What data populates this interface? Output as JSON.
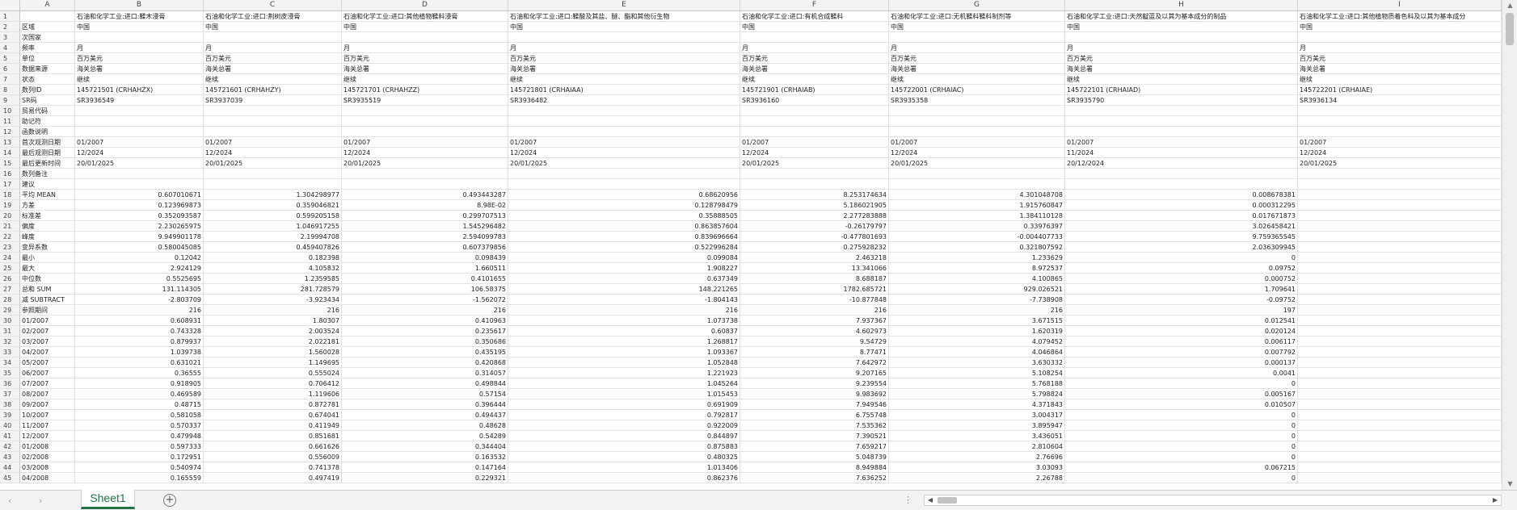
{
  "columns": [
    "A",
    "B",
    "C",
    "D",
    "E",
    "F",
    "G",
    "H",
    "I"
  ],
  "rows": [
    [
      "1",
      "",
      "石油和化学工业:进口:鞣木浸膏",
      "石油和化学工业:进口:荆树皮浸膏",
      "石油和化学工业:进口:其他植物鞣料浸膏",
      "石油和化学工业:进口:鞣酸及其盐、醚、酯和其他衍生物",
      "石油和化学工业:进口:有机合成鞣料",
      "石油和化学工业:进口:无机鞣料鞣料制剂等",
      "石油和化学工业:进口:天然靛蓝及以其为基本成分的制品",
      "石油和化学工业:进口:其他植物质着色料及以其为基本成分"
    ],
    [
      "2",
      "区域",
      "中国",
      "中国",
      "中国",
      "中国",
      "中国",
      "中国",
      "中国",
      "中国"
    ],
    [
      "3",
      "次国家",
      "",
      "",
      "",
      "",
      "",
      "",
      "",
      ""
    ],
    [
      "4",
      "频率",
      "月",
      "月",
      "月",
      "月",
      "月",
      "月",
      "月",
      "月"
    ],
    [
      "5",
      "单位",
      "百万美元",
      "百万美元",
      "百万美元",
      "百万美元",
      "百万美元",
      "百万美元",
      "百万美元",
      "百万美元"
    ],
    [
      "6",
      "数据来源",
      "海关总署",
      "海关总署",
      "海关总署",
      "海关总署",
      "海关总署",
      "海关总署",
      "海关总署",
      "海关总署"
    ],
    [
      "7",
      "状态",
      "继续",
      "继续",
      "继续",
      "继续",
      "继续",
      "继续",
      "继续",
      "继续"
    ],
    [
      "8",
      "数列ID",
      "145721501 (CRHAHZX)",
      "145721601 (CRHAHZY)",
      "145721701 (CRHAHZZ)",
      "145721801 (CRHAIAA)",
      "145721901 (CRHAIAB)",
      "145722001 (CRHAIAC)",
      "145722101 (CRHAIAD)",
      "145722201 (CRHAIAE)"
    ],
    [
      "9",
      "SR码",
      "SR3936549",
      "SR3937039",
      "SR3935519",
      "SR3936482",
      "SR3936160",
      "SR3935358",
      "SR3935790",
      "SR3936134"
    ],
    [
      "10",
      "贸易代码",
      "",
      "",
      "",
      "",
      "",
      "",
      "",
      ""
    ],
    [
      "11",
      "助记符",
      "",
      "",
      "",
      "",
      "",
      "",
      "",
      ""
    ],
    [
      "12",
      "函数说明",
      "",
      "",
      "",
      "",
      "",
      "",
      "",
      ""
    ],
    [
      "13",
      "首次观测日期",
      "01/2007",
      "01/2007",
      "01/2007",
      "01/2007",
      "01/2007",
      "01/2007",
      "01/2007",
      "01/2007"
    ],
    [
      "14",
      "最后观测日期",
      "12/2024",
      "12/2024",
      "12/2024",
      "12/2024",
      "12/2024",
      "12/2024",
      "11/2024",
      "12/2024"
    ],
    [
      "15",
      "最后更新时间",
      "20/01/2025",
      "20/01/2025",
      "20/01/2025",
      "20/01/2025",
      "20/01/2025",
      "20/01/2025",
      "20/12/2024",
      "20/01/2025"
    ],
    [
      "16",
      "数列备注",
      "",
      "",
      "",
      "",
      "",
      "",
      "",
      ""
    ],
    [
      "17",
      "建议",
      "",
      "",
      "",
      "",
      "",
      "",
      "",
      ""
    ],
    [
      "18",
      "平均 MEAN",
      "0.607010671",
      "1.304298977",
      "0.493443287",
      "0.68620956",
      "8.253174634",
      "4.301048708",
      "0.008678381",
      ""
    ],
    [
      "19",
      "方差",
      "0.123969873",
      "0.359046821",
      "8.98E-02",
      "0.128798479",
      "5.186021905",
      "1.915760847",
      "0.000312295",
      ""
    ],
    [
      "20",
      "标准差",
      "0.352093587",
      "0.599205158",
      "0.299707513",
      "0.35888505",
      "2.277283888",
      "1.384110128",
      "0.017671873",
      ""
    ],
    [
      "21",
      "偏度",
      "2.230265975",
      "1.046917255",
      "1.545296482",
      "0.863857604",
      "-0.26179797",
      "0.33976397",
      "3.026458421",
      ""
    ],
    [
      "22",
      "峰度",
      "9.949901178",
      "2.19994708",
      "2.594099783",
      "0.839696664",
      "-0.477801693",
      "-0.004407733",
      "9.759365545",
      ""
    ],
    [
      "23",
      "变异系数",
      "0.580045085",
      "0.459407826",
      "0.607379856",
      "0.522996284",
      "0.275928232",
      "0.321807592",
      "2.036309945",
      ""
    ],
    [
      "24",
      "最小",
      "0.12042",
      "0.182398",
      "0.098439",
      "0.099084",
      "2.463218",
      "1.233629",
      "0",
      ""
    ],
    [
      "25",
      "最大",
      "2.924129",
      "4.105832",
      "1.660511",
      "1.908227",
      "13.341066",
      "8.972537",
      "0.09752",
      ""
    ],
    [
      "26",
      "中位数",
      "0.5525695",
      "1.2359585",
      "0.4101655",
      "0.637349",
      "8.688187",
      "4.100865",
      "0.000752",
      ""
    ],
    [
      "27",
      "总和 SUM",
      "131.114305",
      "281.728579",
      "106.58375",
      "148.221265",
      "1782.685721",
      "929.026521",
      "1.709641",
      ""
    ],
    [
      "28",
      "减 SUBTRACT",
      "-2.803709",
      "-3.923434",
      "-1.562072",
      "-1.804143",
      "-10.877848",
      "-7.738908",
      "-0.09752",
      ""
    ],
    [
      "29",
      "参照期间",
      "216",
      "216",
      "216",
      "216",
      "216",
      "216",
      "197",
      ""
    ],
    [
      "30",
      "01/2007",
      "0.608931",
      "1.80307",
      "0.410963",
      "1.073738",
      "7.937367",
      "3.671515",
      "0.012541",
      ""
    ],
    [
      "31",
      "02/2007",
      "0.743328",
      "2.003524",
      "0.235617",
      "0.60837",
      "4.602973",
      "1.620319",
      "0.020124",
      ""
    ],
    [
      "32",
      "03/2007",
      "0.879937",
      "2.022181",
      "0.350686",
      "1.268817",
      "9.54729",
      "4.079452",
      "0.006117",
      ""
    ],
    [
      "33",
      "04/2007",
      "1.039738",
      "1.560028",
      "0.435195",
      "1.093367",
      "8.77471",
      "4.046864",
      "0.007792",
      ""
    ],
    [
      "34",
      "05/2007",
      "0.631021",
      "1.149695",
      "0.420868",
      "1.052848",
      "7.642972",
      "3.630332",
      "0.000137",
      ""
    ],
    [
      "35",
      "06/2007",
      "0.36555",
      "0.555024",
      "0.314057",
      "1.221923",
      "9.207165",
      "5.108254",
      "0.0041",
      ""
    ],
    [
      "36",
      "07/2007",
      "0.918905",
      "0.706412",
      "0.498844",
      "1.045264",
      "9.239554",
      "5.768188",
      "0",
      ""
    ],
    [
      "37",
      "08/2007",
      "0.469589",
      "1.119606",
      "0.57154",
      "1.015453",
      "9.983692",
      "5.798824",
      "0.005167",
      ""
    ],
    [
      "38",
      "09/2007",
      "0.48715",
      "0.872781",
      "0.396444",
      "0.691909",
      "7.949546",
      "4.371843",
      "0.010507",
      ""
    ],
    [
      "39",
      "10/2007",
      "0.581058",
      "0.674041",
      "0.494437",
      "0.792817",
      "6.755748",
      "3.004317",
      "0",
      ""
    ],
    [
      "40",
      "11/2007",
      "0.570337",
      "0.411949",
      "0.48628",
      "0.922009",
      "7.535362",
      "3.895947",
      "0",
      ""
    ],
    [
      "41",
      "12/2007",
      "0.479948",
      "0.851681",
      "0.54289",
      "0.844897",
      "7.390521",
      "3.436051",
      "0",
      ""
    ],
    [
      "42",
      "01/2008",
      "0.597333",
      "0.661626",
      "0.344404",
      "0.875883",
      "7.659217",
      "2.810604",
      "0",
      ""
    ],
    [
      "43",
      "02/2008",
      "0.172951",
      "0.556009",
      "0.163532",
      "0.480325",
      "5.048739",
      "2.76696",
      "0",
      ""
    ],
    [
      "44",
      "03/2008",
      "0.540974",
      "0.741378",
      "0.147164",
      "1.013406",
      "8.949884",
      "3.03093",
      "0.067215",
      ""
    ],
    [
      "45",
      "04/2008",
      "0.165559",
      "0.497419",
      "0.229321",
      "0.862376",
      "7.636252",
      "2.26788",
      "0",
      ""
    ]
  ],
  "sheet_tabs": [
    "Sheet1"
  ],
  "icons": {
    "nav_prev": "chevron-left-icon",
    "nav_next": "chevron-right-icon",
    "add_sheet": "plus-circle-icon",
    "more": "ellipsis-icon",
    "scroll_up": "triangle-up-icon",
    "scroll_down": "triangle-down-icon",
    "scroll_left": "triangle-left-icon",
    "scroll_right": "triangle-right-icon"
  },
  "colors": {
    "header_bg": "#f3f3f3",
    "grid_line": "#e3e3e3",
    "sheet_tab_accent": "#217346"
  }
}
